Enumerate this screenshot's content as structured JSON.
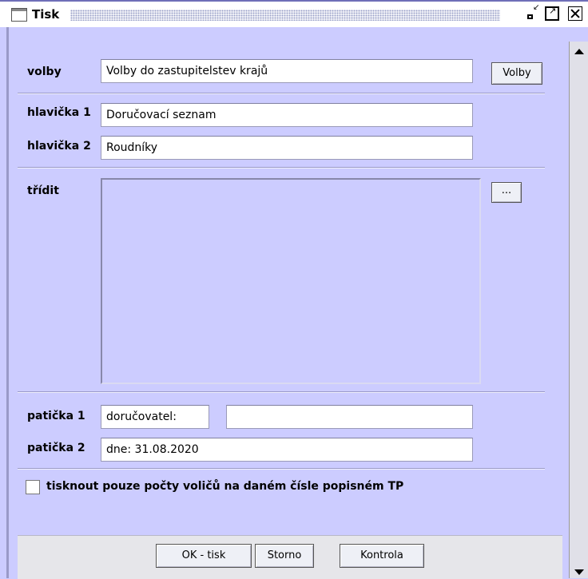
{
  "window": {
    "title": "Tisk"
  },
  "form": {
    "volby_label": "volby",
    "volby_value": "Volby do zastupitelstev krajů",
    "volby_button": "Volby",
    "hlavicka1_label": "hlavička 1",
    "hlavicka1_value": "Doručovací seznam",
    "hlavicka2_label": "hlavička 2",
    "hlavicka2_value": "Roudníky",
    "tridit_label": "třídit",
    "tridit_button": "...",
    "paticka1_label": "patička 1",
    "paticka1_value": "doručovatel:",
    "paticka1_value2": "",
    "paticka2_label": "patička 2",
    "paticka2_value": "dne: 31.08.2020",
    "checkbox_label": "tisknout pouze počty voličů na daném čísle popisném TP",
    "checkbox_checked": false
  },
  "buttons": {
    "ok": "OK - tisk",
    "storno": "Storno",
    "kontrola": "Kontrola"
  }
}
